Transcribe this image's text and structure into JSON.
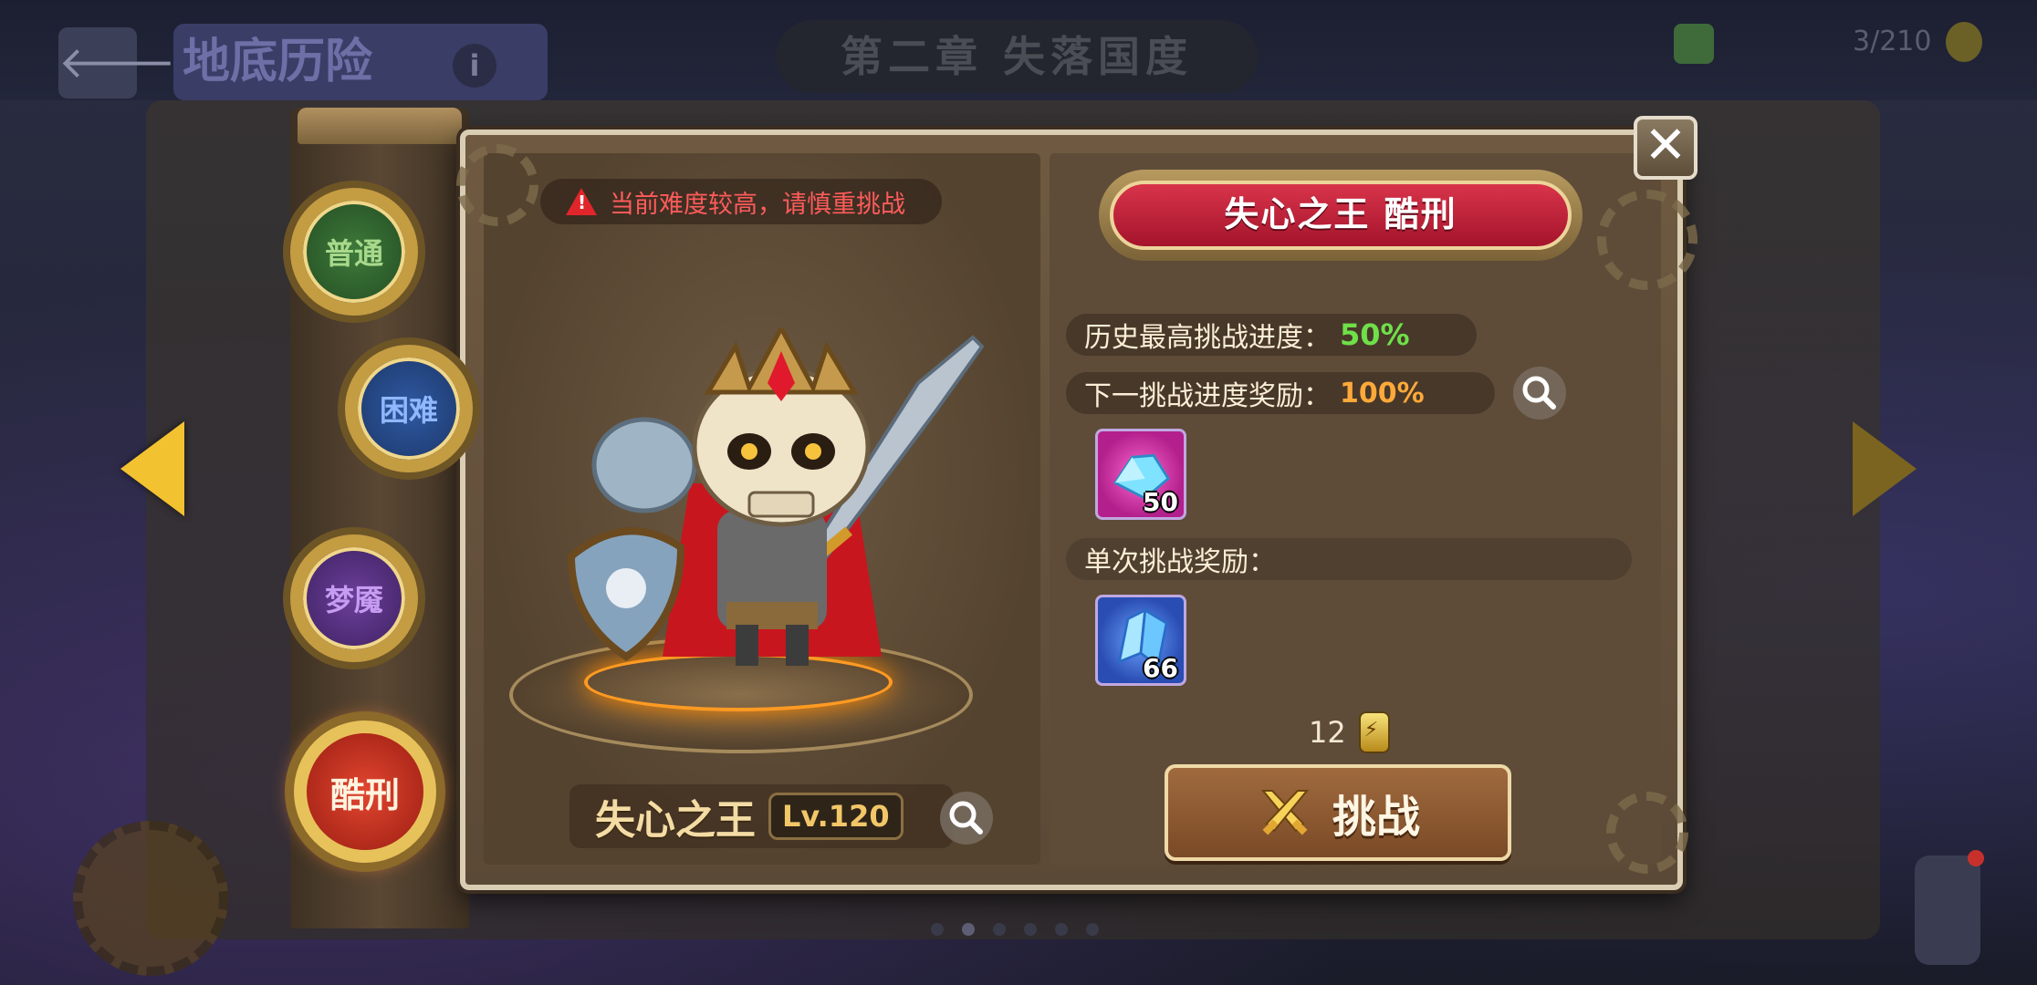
{
  "background": {
    "screen_title": "地底历险",
    "chapter": "第二章 失落国度",
    "stamina_count": "3/210",
    "page_dots": 6
  },
  "dialog": {
    "warning": "当前难度较高，请慎重挑战",
    "boss_title": "失心之王 酷刑",
    "character_name": "失心之王",
    "character_level": "Lv.120",
    "best_progress_label": "历史最高挑战进度：",
    "best_progress_value": "50%",
    "next_reward_label": "下一挑战进度奖励：",
    "next_reward_value": "100%",
    "next_rewards": [
      {
        "icon": "pink-crystal-icon",
        "count": "50"
      }
    ],
    "single_reward_label": "单次挑战奖励：",
    "single_rewards": [
      {
        "icon": "blue-crystal-icon",
        "count": "66"
      }
    ],
    "cost": "12",
    "challenge_button": "挑战"
  },
  "difficulties": [
    {
      "label": "普通",
      "color": "#3d7a3a"
    },
    {
      "label": "困难",
      "color": "#2f5aa3"
    },
    {
      "label": "梦魇",
      "color": "#6b3f9a"
    },
    {
      "label": "酷刑",
      "color": "#e2462f",
      "selected": true
    }
  ],
  "colors": {
    "accent_green": "#6fe04a",
    "accent_orange": "#ffa93a",
    "warning_red": "#ff5b5b",
    "title_red": "#c9223a"
  }
}
